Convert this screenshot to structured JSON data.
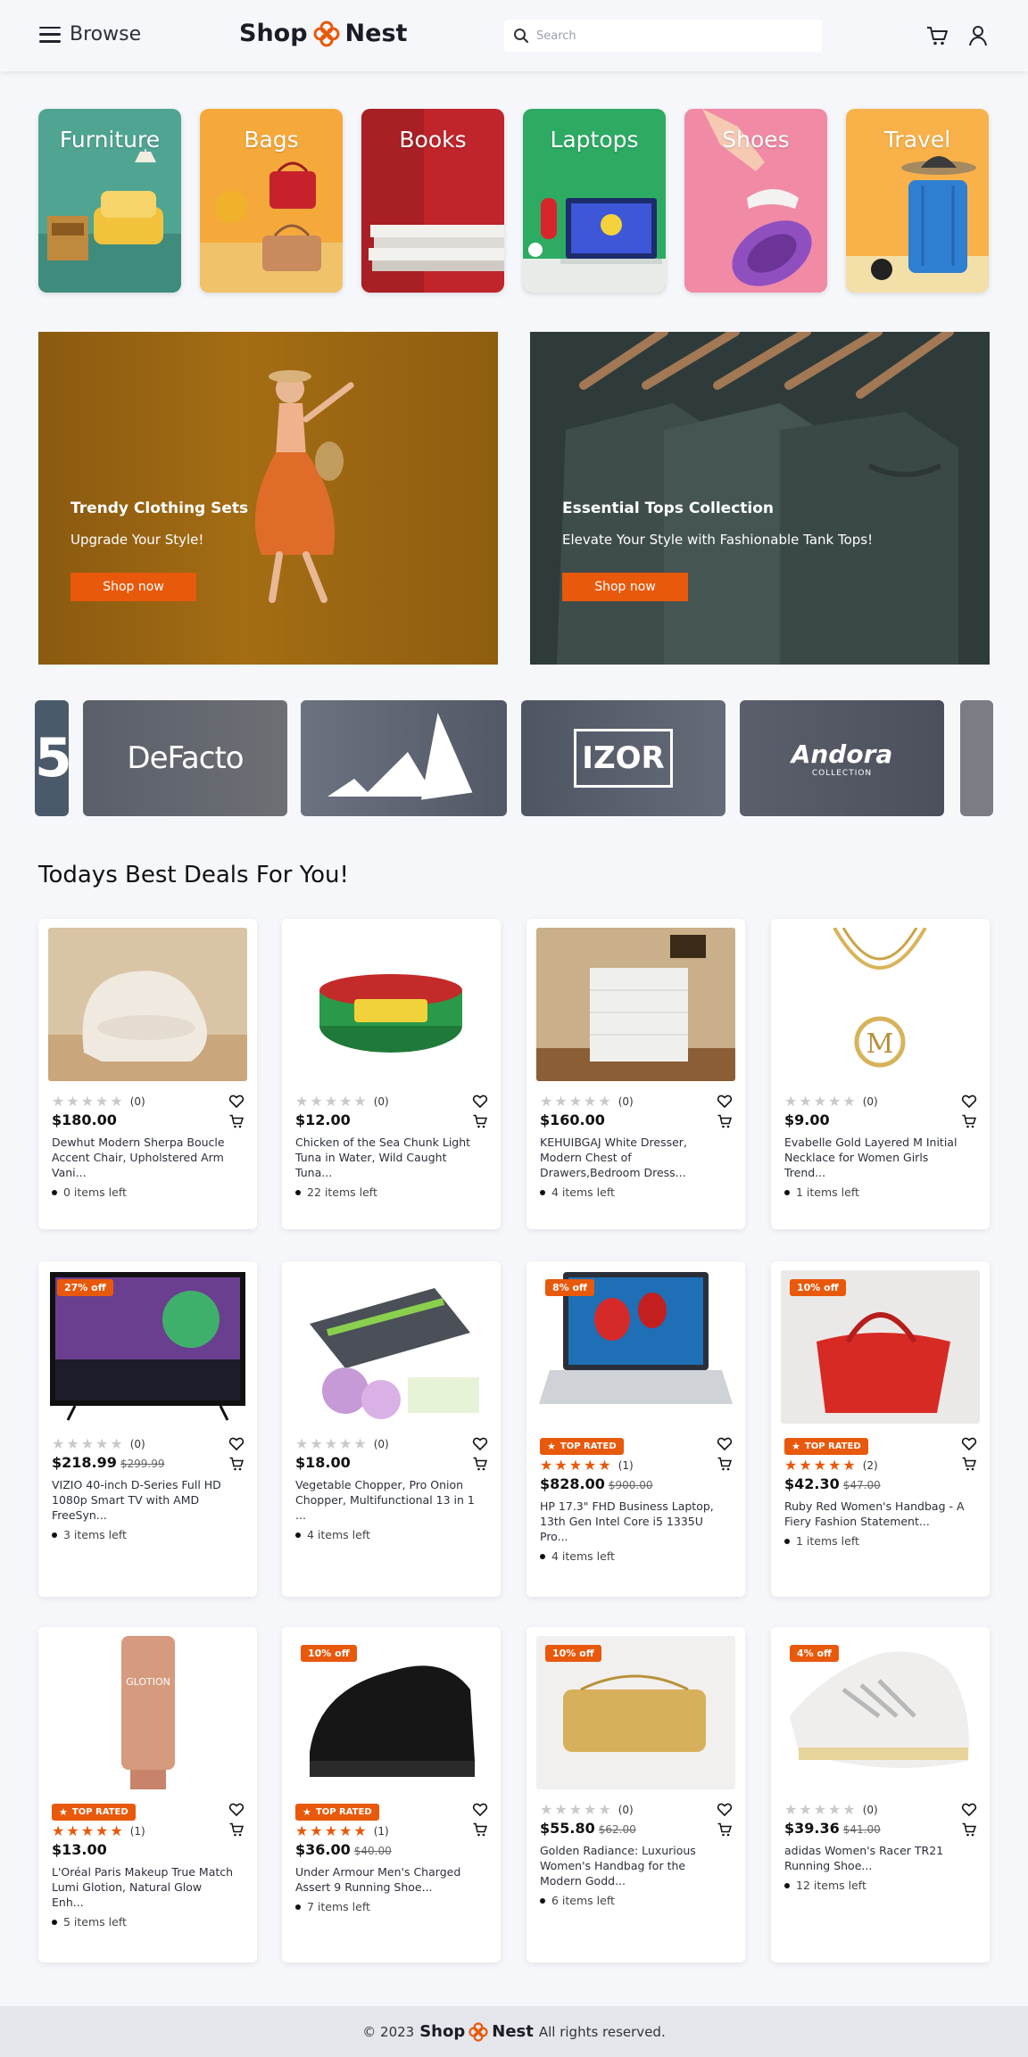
{
  "header": {
    "browse_label": "Browse",
    "logo_left": "Shop",
    "logo_right": "Nest",
    "search_placeholder": "Search",
    "accent": "#e8590c"
  },
  "categories": [
    {
      "label": "Furniture",
      "color": "#4fa592"
    },
    {
      "label": "Bags",
      "color": "#f6a93b"
    },
    {
      "label": "Books",
      "color": "#c0252b"
    },
    {
      "label": "Laptops",
      "color": "#2dab62"
    },
    {
      "label": "Shoes",
      "color": "#f08aa5"
    },
    {
      "label": "Travel",
      "color": "#f9b24a"
    }
  ],
  "banners": [
    {
      "title": "Trendy Clothing Sets",
      "subtitle": "Upgrade Your Style!",
      "button": "Shop now"
    },
    {
      "title": "Essential Tops Collection",
      "subtitle": "Elevate Your Style with Fashionable Tank Tops!",
      "button": "Shop now"
    }
  ],
  "brands": [
    "DeFacto",
    "IZOR",
    "Andora",
    "COLLECTION"
  ],
  "deals_title": "Todays Best Deals For You!",
  "products": [
    {
      "price": "$180.00",
      "old": "",
      "rating": 0,
      "count": "(0)",
      "title": "Dewhut Modern Sherpa Boucle Accent Chair, Upholstered Arm Vani...",
      "left": "0 items left",
      "off": "",
      "top_rated": false
    },
    {
      "price": "$12.00",
      "old": "",
      "rating": 0,
      "count": "(0)",
      "title": "Chicken of the Sea Chunk Light Tuna in Water, Wild Caught Tuna...",
      "left": "22 items left",
      "off": "",
      "top_rated": false
    },
    {
      "price": "$160.00",
      "old": "",
      "rating": 0,
      "count": "(0)",
      "title": "KEHUIBGAJ White Dresser, Modern Chest of Drawers,Bedroom Dress...",
      "left": "4 items left",
      "off": "",
      "top_rated": false
    },
    {
      "price": "$9.00",
      "old": "",
      "rating": 0,
      "count": "(0)",
      "title": "Evabelle Gold Layered M Initial Necklace for Women Girls Trend...",
      "left": "1 items left",
      "off": "",
      "top_rated": false
    },
    {
      "price": "$218.99",
      "old": "$299.99",
      "rating": 0,
      "count": "(0)",
      "title": "VIZIO 40-inch D-Series Full HD 1080p Smart TV with AMD FreeSyn...",
      "left": "3 items left",
      "off": "27% off",
      "top_rated": false
    },
    {
      "price": "$18.00",
      "old": "",
      "rating": 0,
      "count": "(0)",
      "title": "Vegetable Chopper, Pro Onion Chopper, Multifunctional 13 in 1 ...",
      "left": "4 items left",
      "off": "",
      "top_rated": false
    },
    {
      "price": "$828.00",
      "old": "$900.00",
      "rating": 5,
      "count": "(1)",
      "title": "HP 17.3\" FHD Business Laptop, 13th Gen Intel Core i5 1335U Pro...",
      "left": "4 items left",
      "off": "8% off",
      "top_rated": true
    },
    {
      "price": "$42.30",
      "old": "$47.00",
      "rating": 5,
      "count": "(2)",
      "title": "Ruby Red Women's Handbag - A Fiery Fashion Statement...",
      "left": "1 items left",
      "off": "10% off",
      "top_rated": true
    },
    {
      "price": "$13.00",
      "old": "",
      "rating": 5,
      "count": "(1)",
      "title": "L'Oréal Paris Makeup True Match Lumi Glotion, Natural Glow Enh...",
      "left": "5 items left",
      "off": "",
      "top_rated": true
    },
    {
      "price": "$36.00",
      "old": "$40.00",
      "rating": 5,
      "count": "(1)",
      "title": "Under Armour Men's Charged Assert 9 Running Shoe...",
      "left": "7 items left",
      "off": "10% off",
      "top_rated": true
    },
    {
      "price": "$55.80",
      "old": "$62.00",
      "rating": 0,
      "count": "(0)",
      "title": "Golden Radiance: Luxurious Women's Handbag for the Modern Godd...",
      "left": "6 items left",
      "off": "10% off",
      "top_rated": false
    },
    {
      "price": "$39.36",
      "old": "$41.00",
      "rating": 0,
      "count": "(0)",
      "title": "adidas Women's Racer TR21 Running Shoe...",
      "left": "12 items left",
      "off": "4% off",
      "top_rated": false
    }
  ],
  "top_rated_label": "TOP RATED",
  "footer": {
    "copyright": "© 2023",
    "brand_left": "Shop",
    "brand_right": "Nest",
    "rights": "All rights reserved."
  }
}
